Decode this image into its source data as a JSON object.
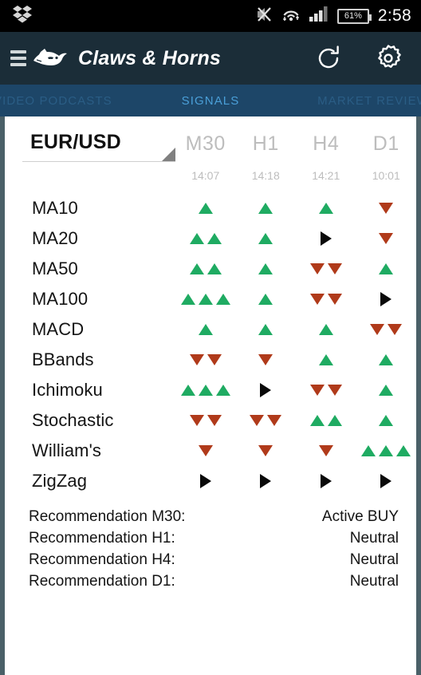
{
  "status_bar": {
    "notification_icon": "dropbox-icon",
    "icons": [
      "vibrate-mute-icon",
      "wifi-icon",
      "cellular-signal-icon"
    ],
    "battery_label": "61%",
    "time": "2:58"
  },
  "app_bar": {
    "menu_icon": "hamburger-menu-icon",
    "logo_icon": "bull-bear-logo-icon",
    "title": "Claws & Horns",
    "refresh_icon": "refresh-icon",
    "settings_icon": "gear-icon"
  },
  "tabs": [
    {
      "label": "VIDEO PODCASTS",
      "active": false
    },
    {
      "label": "SIGNALS",
      "active": true
    },
    {
      "label": "MARKET REVIEW",
      "active": false
    }
  ],
  "instrument": {
    "selected": "EUR/USD",
    "caret_icon": "dropdown-caret-icon"
  },
  "columns": [
    {
      "timeframe": "M30",
      "updated": "14:07"
    },
    {
      "timeframe": "H1",
      "updated": "14:18"
    },
    {
      "timeframe": "H4",
      "updated": "14:21"
    },
    {
      "timeframe": "D1",
      "updated": "10:01"
    }
  ],
  "signal_rows": [
    {
      "indicator": "MA10",
      "cells": [
        {
          "dir": "up",
          "count": 1
        },
        {
          "dir": "up",
          "count": 1
        },
        {
          "dir": "up",
          "count": 1
        },
        {
          "dir": "down",
          "count": 1
        }
      ]
    },
    {
      "indicator": "MA20",
      "cells": [
        {
          "dir": "up",
          "count": 2
        },
        {
          "dir": "up",
          "count": 1
        },
        {
          "dir": "flat",
          "count": 1
        },
        {
          "dir": "down",
          "count": 1
        }
      ]
    },
    {
      "indicator": "MA50",
      "cells": [
        {
          "dir": "up",
          "count": 2
        },
        {
          "dir": "up",
          "count": 1
        },
        {
          "dir": "down",
          "count": 2
        },
        {
          "dir": "up",
          "count": 1
        }
      ]
    },
    {
      "indicator": "MA100",
      "cells": [
        {
          "dir": "up",
          "count": 3
        },
        {
          "dir": "up",
          "count": 1
        },
        {
          "dir": "down",
          "count": 2
        },
        {
          "dir": "flat",
          "count": 1
        }
      ]
    },
    {
      "indicator": "MACD",
      "cells": [
        {
          "dir": "up",
          "count": 1
        },
        {
          "dir": "up",
          "count": 1
        },
        {
          "dir": "up",
          "count": 1
        },
        {
          "dir": "down",
          "count": 2
        }
      ]
    },
    {
      "indicator": "BBands",
      "cells": [
        {
          "dir": "down",
          "count": 2
        },
        {
          "dir": "down",
          "count": 1
        },
        {
          "dir": "up",
          "count": 1
        },
        {
          "dir": "up",
          "count": 1
        }
      ]
    },
    {
      "indicator": "Ichimoku",
      "cells": [
        {
          "dir": "up",
          "count": 3
        },
        {
          "dir": "flat",
          "count": 1
        },
        {
          "dir": "down",
          "count": 2
        },
        {
          "dir": "up",
          "count": 1
        }
      ]
    },
    {
      "indicator": "Stochastic",
      "cells": [
        {
          "dir": "down",
          "count": 2
        },
        {
          "dir": "down",
          "count": 2
        },
        {
          "dir": "up",
          "count": 2
        },
        {
          "dir": "up",
          "count": 1
        }
      ]
    },
    {
      "indicator": "William's",
      "cells": [
        {
          "dir": "down",
          "count": 1
        },
        {
          "dir": "down",
          "count": 1
        },
        {
          "dir": "down",
          "count": 1
        },
        {
          "dir": "up",
          "count": 3
        }
      ]
    },
    {
      "indicator": "ZigZag",
      "cells": [
        {
          "dir": "flat",
          "count": 1
        },
        {
          "dir": "flat",
          "count": 1
        },
        {
          "dir": "flat",
          "count": 1
        },
        {
          "dir": "flat",
          "count": 1
        }
      ]
    }
  ],
  "recommendations": [
    {
      "label": "Recommendation M30:",
      "value": "Active BUY"
    },
    {
      "label": "Recommendation H1:",
      "value": "Neutral"
    },
    {
      "label": "Recommendation H4:",
      "value": "Neutral"
    },
    {
      "label": "Recommendation D1:",
      "value": "Neutral"
    }
  ],
  "colors": {
    "status_bar_bg": "#000000",
    "app_bar_bg": "#1b2d38",
    "tab_bar_bg": "#1d4668",
    "tab_active": "#4a9fd8",
    "tab_inactive": "#2a5d85",
    "page_edge": "#4a6068",
    "signal_up": "#1fab62",
    "signal_down": "#b03a1a",
    "signal_flat": "#0a0a0a",
    "sheet_bg": "#ffffff"
  }
}
